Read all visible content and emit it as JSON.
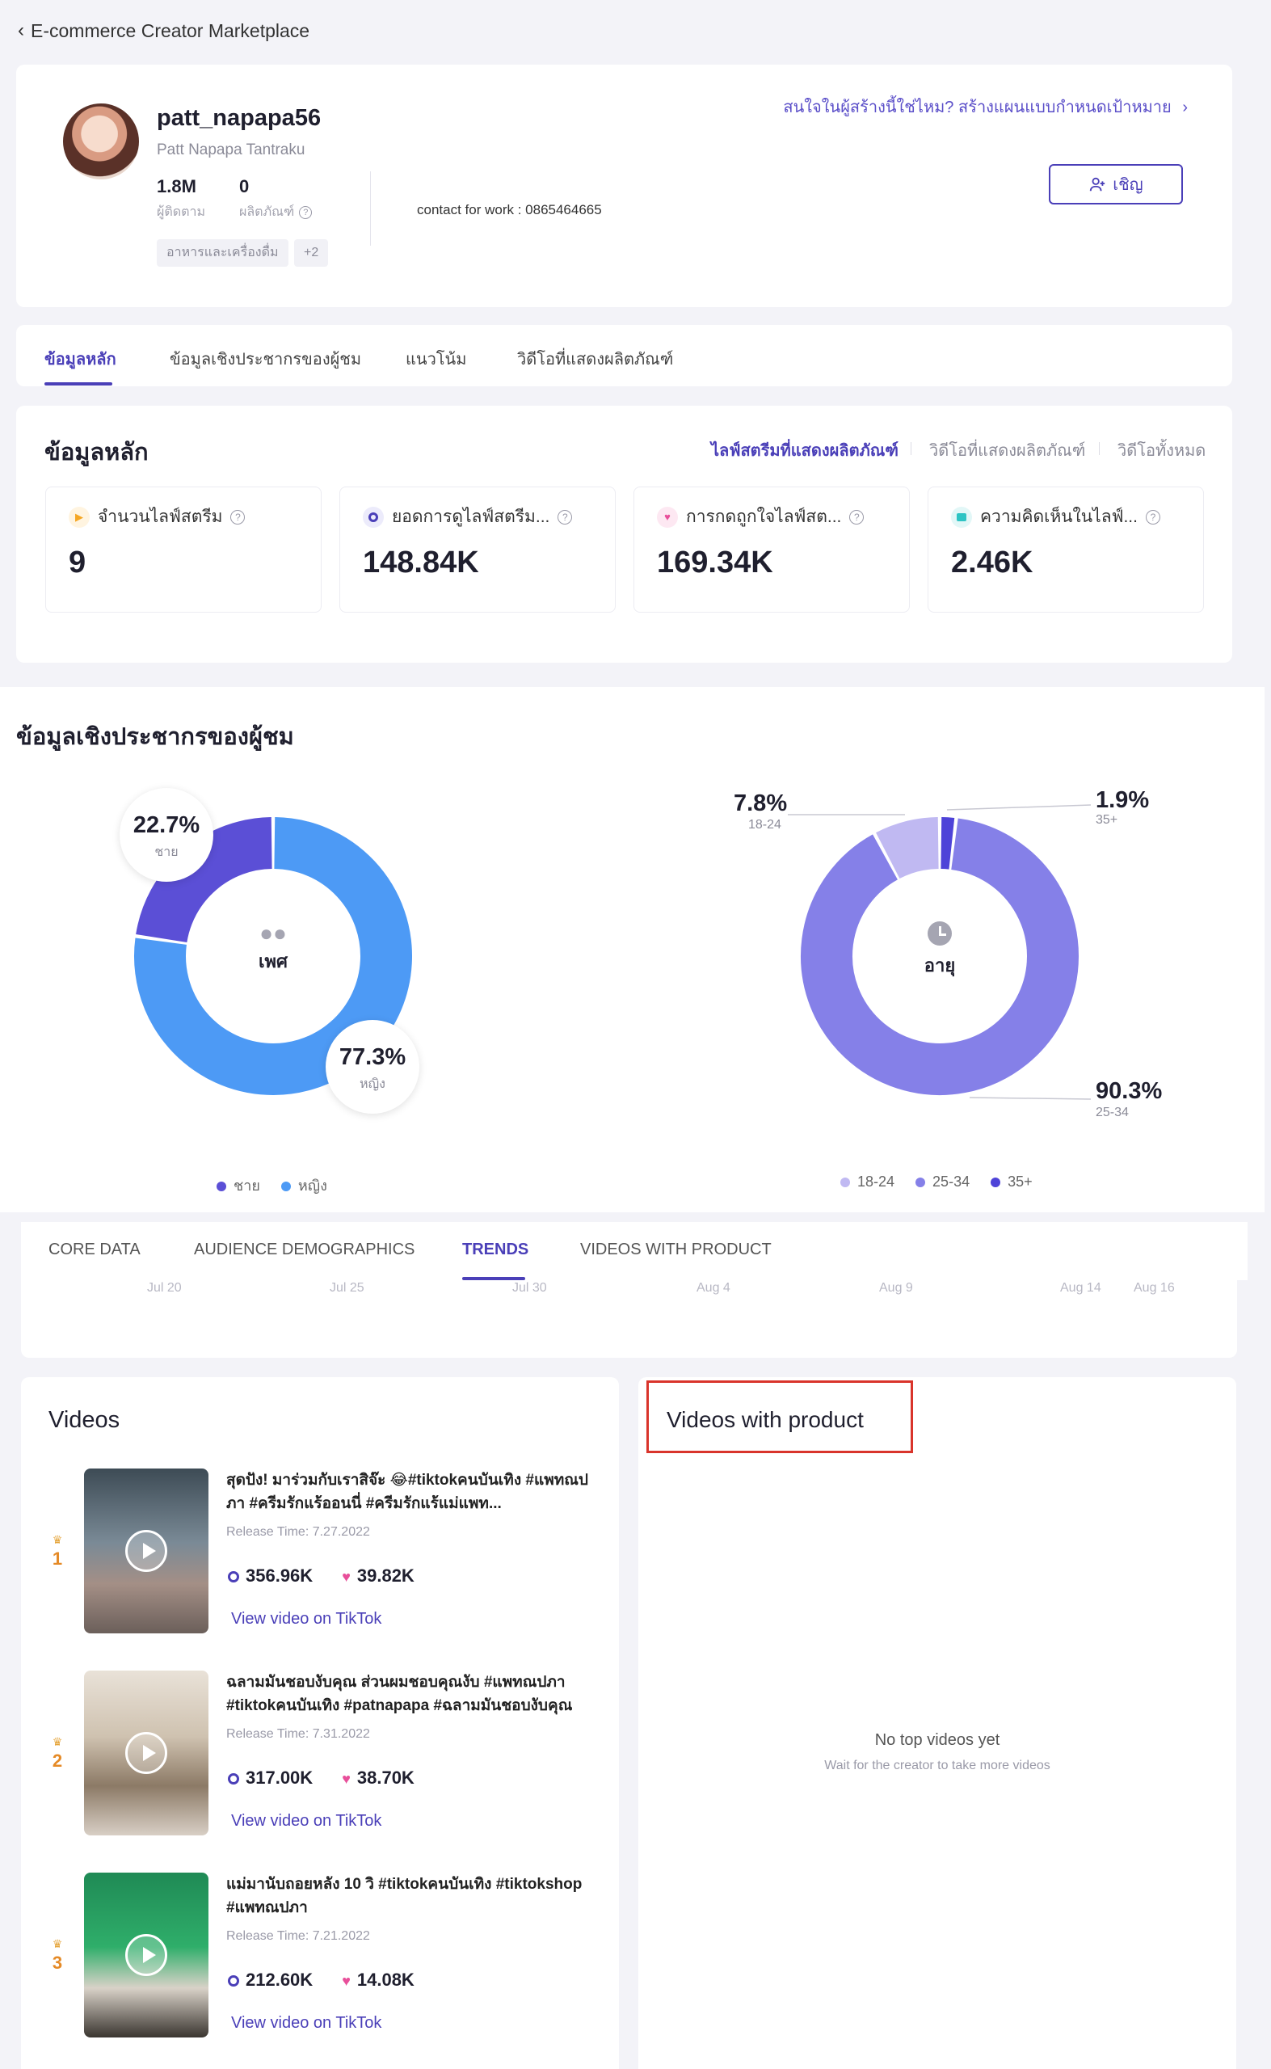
{
  "header": {
    "back_label": "E-commerce Creator Marketplace"
  },
  "profile": {
    "username": "patt_napapa56",
    "full_name": "Patt Napapa Tantraku",
    "followers": {
      "value": "1.8M",
      "label": "ผู้ติดตาม"
    },
    "products": {
      "value": "0",
      "label": "ผลิตภัณฑ์"
    },
    "tags": [
      "อาหารและเครื่องดื่ม",
      "+2"
    ],
    "contact": "contact for work : 0865464665",
    "promo_text": "สนใจในผู้สร้างนี้ใช่ไหม? สร้างแผนแบบกำหนดเป้าหมาย",
    "invite_label": "เชิญ"
  },
  "tabs": [
    "ข้อมูลหลัก",
    "ข้อมูลเชิงประชากรของผู้ชม",
    "แนวโน้ม",
    "วิดีโอที่แสดงผลิตภัณฑ์"
  ],
  "core": {
    "title": "ข้อมูลหลัก",
    "sublinks": [
      "ไลฟ์สตรีมที่แสดงผลิตภัณฑ์",
      "วิดีโอที่แสดงผลิตภัณฑ์",
      "วิดีโอทั้งหมด"
    ],
    "metrics": [
      {
        "label": "จำนวนไลฟ์สตรีม",
        "value": "9",
        "icon": "play-icon",
        "color": "#f5a623"
      },
      {
        "label": "ยอดการดูไลฟ์สตรีม...",
        "value": "148.84K",
        "icon": "eye-icon",
        "color": "#4a3fb8"
      },
      {
        "label": "การกดถูกใจไลฟ์สต...",
        "value": "169.34K",
        "icon": "heart-icon",
        "color": "#e84f9a"
      },
      {
        "label": "ความคิดเห็นในไลฟ์...",
        "value": "2.46K",
        "icon": "comment-icon",
        "color": "#2ec4c4"
      }
    ]
  },
  "demographics": {
    "title": "ข้อมูลเชิงประชากรของผู้ชม",
    "gender": {
      "center_label": "เพศ",
      "slices": [
        {
          "name": "ชาย",
          "pct": 22.7,
          "display": "22.7%",
          "color": "#5b4fd6"
        },
        {
          "name": "หญิง",
          "pct": 77.3,
          "display": "77.3%",
          "color": "#4d9af5"
        }
      ]
    },
    "age": {
      "center_label": "อายุ",
      "slices": [
        {
          "name": "18-24",
          "pct": 7.8,
          "display": "7.8%",
          "color": "#c0b9f2"
        },
        {
          "name": "25-34",
          "pct": 90.3,
          "display": "90.3%",
          "color": "#8580e8"
        },
        {
          "name": "35+",
          "pct": 1.9,
          "display": "1.9%",
          "color": "#4e43d8"
        }
      ]
    }
  },
  "trends": {
    "tabs": [
      "CORE DATA",
      "AUDIENCE DEMOGRAPHICS",
      "TRENDS",
      "VIDEOS WITH PRODUCT"
    ],
    "axis": [
      "Jul 20",
      "Jul 25",
      "Jul 30",
      "Aug 4",
      "Aug 9",
      "Aug 14",
      "Aug 16"
    ]
  },
  "videos": {
    "title": "Videos",
    "link_label": "View video on TikTok",
    "items": [
      {
        "rank": "1",
        "title": "สุดปัง! มาร่วมกับเราสิจ๊ะ 😂#tiktokคนบันเทิง #แพทณปภา #ครีมรักแร้ออนนี่ #ครีมรักแร้แม่แพท...",
        "release": "Release Time: 7.27.2022",
        "views": "356.96K",
        "likes": "39.82K"
      },
      {
        "rank": "2",
        "title": "ฉลามมันชอบงับคุณ ส่วนผมชอบคุณงับ #แพทณปภา #tiktokคนบันเทิง #patnapapa #ฉลามมันชอบงับคุณ",
        "release": "Release Time: 7.31.2022",
        "views": "317.00K",
        "likes": "38.70K"
      },
      {
        "rank": "3",
        "title": "แม่มานับถอยหลัง 10 วิ #tiktokคนบันเทิง #tiktokshop #แพทณปภา",
        "release": "Release Time: 7.21.2022",
        "views": "212.60K",
        "likes": "14.08K"
      }
    ]
  },
  "videos_with_product": {
    "title": "Videos with product",
    "empty_title": "No top videos yet",
    "empty_sub": "Wait for the creator to take more videos"
  }
}
